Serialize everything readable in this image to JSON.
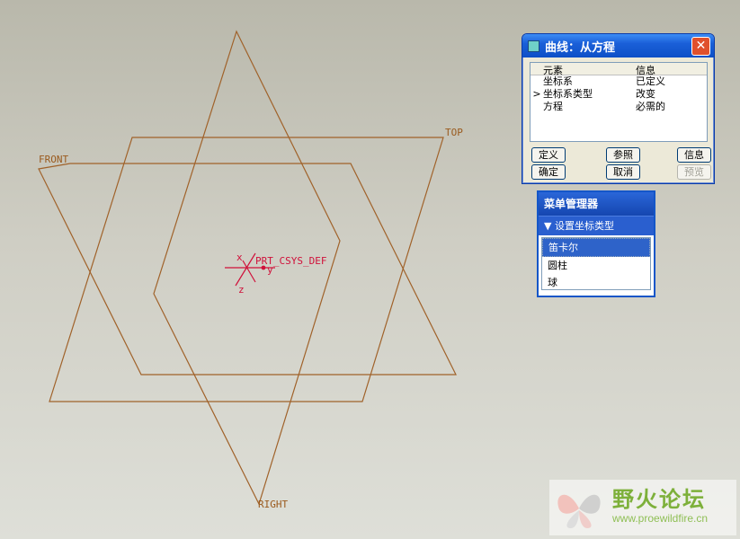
{
  "viewport": {
    "planes": [
      {
        "name": "FRONT"
      },
      {
        "name": "TOP"
      },
      {
        "name": "RIGHT"
      }
    ],
    "csys_label": "PRT_CSYS_DEF",
    "axis_x": "x",
    "axis_y": "y",
    "axis_z": "z",
    "colors": {
      "plane": "#a0622a",
      "csys": "#d0103a"
    }
  },
  "dialog": {
    "title": "曲线：从方程",
    "close_label": "✕",
    "columns": {
      "element": "元素",
      "info": "信息"
    },
    "rows": [
      {
        "marker": "",
        "element": "坐标系",
        "info": "已定义"
      },
      {
        "marker": ">",
        "element": "坐标系类型",
        "info": "改变"
      },
      {
        "marker": "",
        "element": "方程",
        "info": "必需的"
      }
    ],
    "buttons": {
      "define": "定义",
      "refs": "参照",
      "info": "信息",
      "ok": "确定",
      "cancel": "取消",
      "preview": "预览"
    }
  },
  "menu_manager": {
    "title": "菜单管理器",
    "submenu": "设置坐标类型",
    "items": [
      "笛卡尔",
      "圆柱",
      "球"
    ],
    "selected_index": 0
  },
  "watermark": {
    "site_name": "野火论坛",
    "url": "www.proewildfire.cn"
  }
}
